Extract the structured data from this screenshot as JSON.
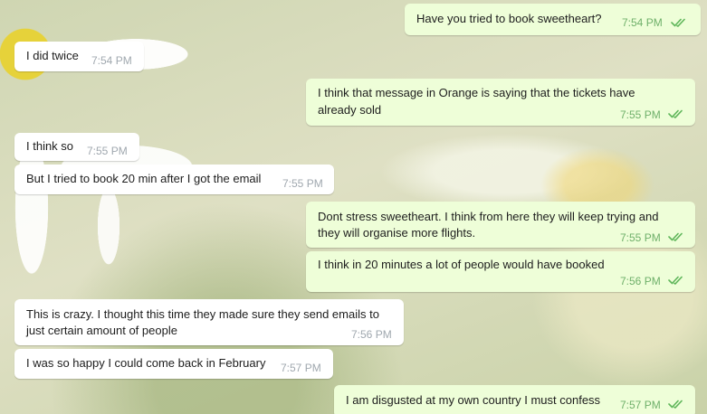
{
  "conversation": {
    "messages": [
      {
        "direction": "outgoing",
        "lines": [
          "Have you tried to book sweetheart?"
        ],
        "time": "7:54 PM",
        "status_icon": "double-check-icon"
      },
      {
        "direction": "incoming",
        "lines": [
          "I did twice"
        ],
        "time": "7:54 PM"
      },
      {
        "direction": "outgoing",
        "lines": [
          "I think that message in Orange is saying that the tickets have",
          "already sold"
        ],
        "time": "7:55 PM",
        "status_icon": "double-check-icon"
      },
      {
        "direction": "incoming",
        "lines": [
          "I think so"
        ],
        "time": "7:55 PM"
      },
      {
        "direction": "incoming",
        "lines": [
          "But I tried to book 20 min after I got the email"
        ],
        "time": "7:55 PM"
      },
      {
        "direction": "outgoing",
        "lines": [
          "Dont stress sweetheart. I think from here they will keep trying and",
          "they will organise more flights."
        ],
        "time": "7:55 PM",
        "status_icon": "double-check-icon"
      },
      {
        "direction": "outgoing",
        "lines": [
          "I think in 20 minutes a lot of people would have booked"
        ],
        "time": "7:56 PM",
        "status_icon": "double-check-icon"
      },
      {
        "direction": "incoming",
        "lines": [
          "This is crazy. I thought this time they made sure they send emails to",
          "just certain amount of people"
        ],
        "time": "7:56 PM"
      },
      {
        "direction": "incoming",
        "lines": [
          "I was so happy I could come back in February"
        ],
        "time": "7:57 PM"
      },
      {
        "direction": "outgoing",
        "lines": [
          "I am disgusted at my own country I must confess"
        ],
        "time": "7:57 PM",
        "status_icon": "double-check-icon"
      }
    ]
  },
  "colors": {
    "incoming_bubble": "#ffffff",
    "outgoing_bubble": "#eefed8",
    "outgoing_time": "#6fb06a",
    "incoming_time": "#a0a8af",
    "check": "#5fb65a"
  }
}
